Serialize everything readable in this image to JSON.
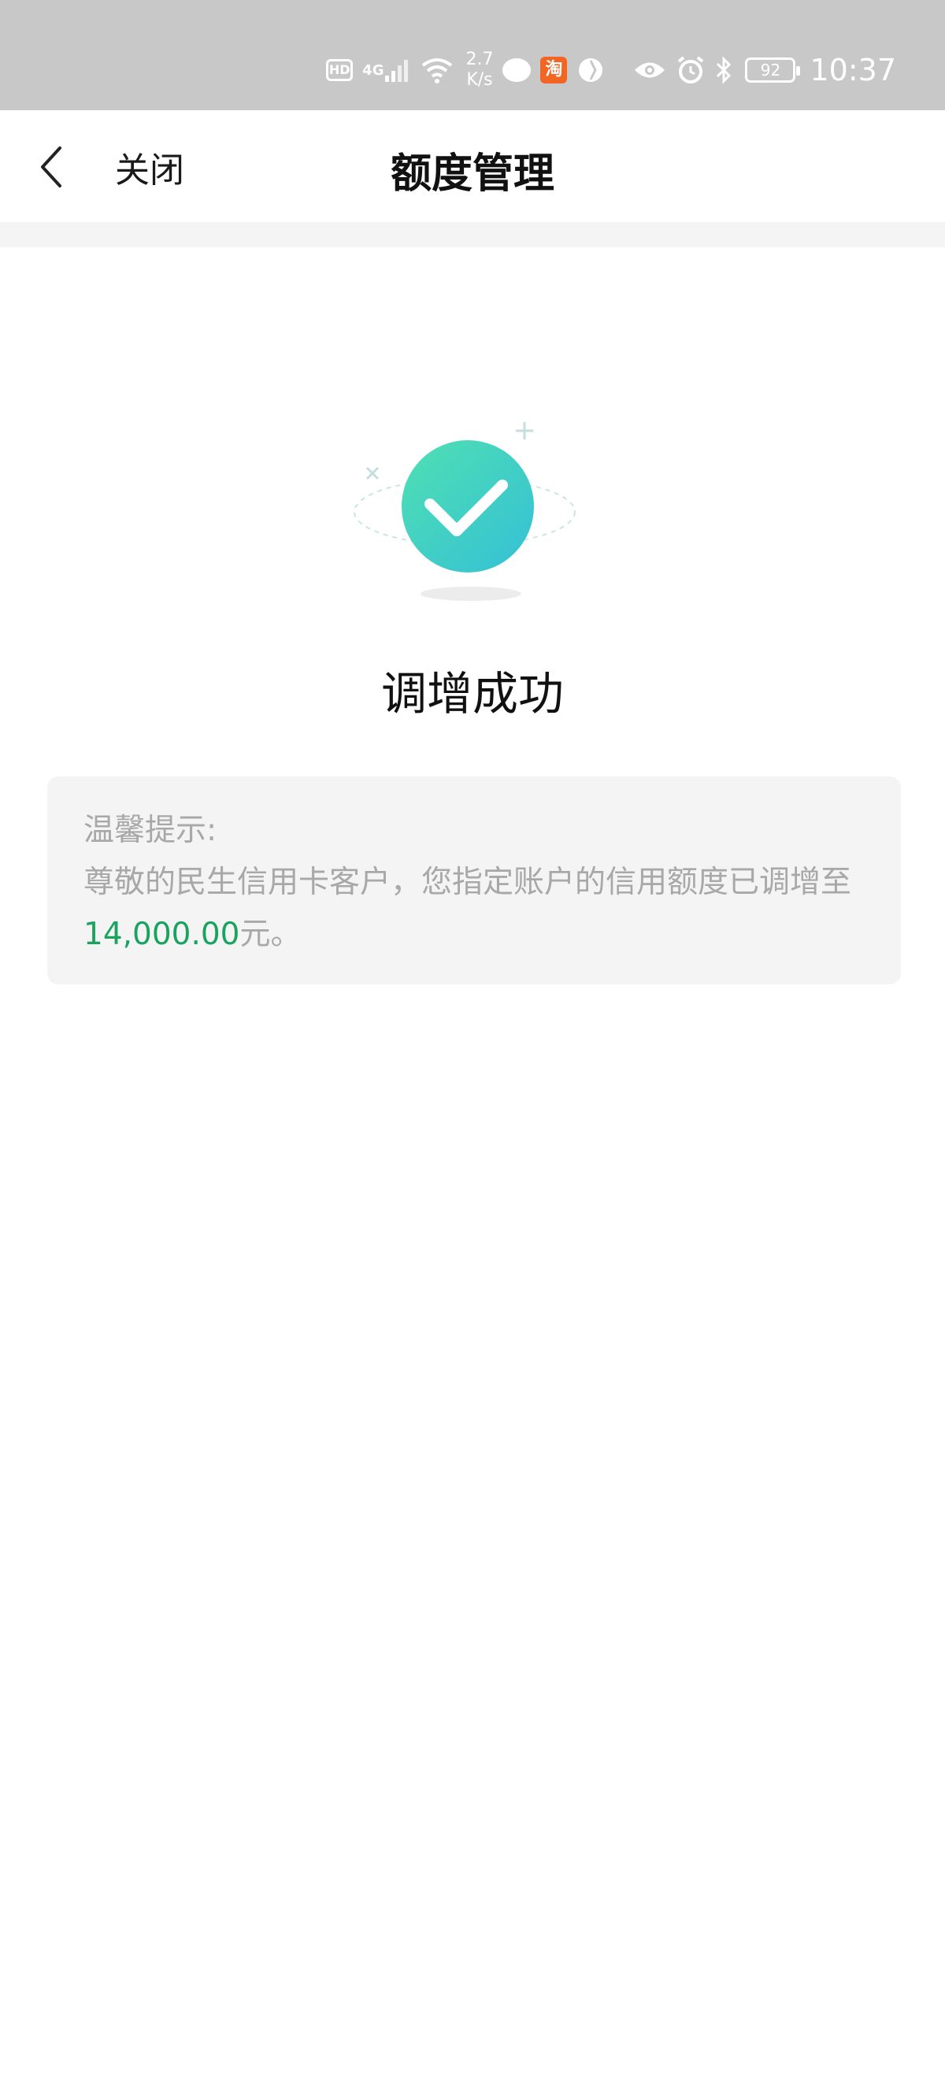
{
  "status_bar": {
    "hd": "HD",
    "network": "4G",
    "speed_value": "2.7",
    "speed_unit": "K/s",
    "taobao": "淘",
    "battery": "92",
    "time": "10:37",
    "icons": [
      "hd-icon",
      "signal-icon",
      "wifi-icon",
      "message-icon",
      "taobao-app-icon",
      "browser-app-icon",
      "eye-icon",
      "alarm-icon",
      "bluetooth-icon",
      "battery-icon"
    ]
  },
  "nav": {
    "back_icon": "chevron-left-icon",
    "close_label": "关闭",
    "title": "额度管理"
  },
  "result": {
    "icon": "success-check-icon",
    "accent_color": "#3fcfb0",
    "title": "调增成功"
  },
  "tip": {
    "heading": "温馨提示:",
    "message_prefix": "尊敬的民生信用卡客户，您指定账户的信用额度已调增至",
    "amount": "14,000.00",
    "amount_color": "#1aa35f",
    "message_suffix": "元。"
  }
}
